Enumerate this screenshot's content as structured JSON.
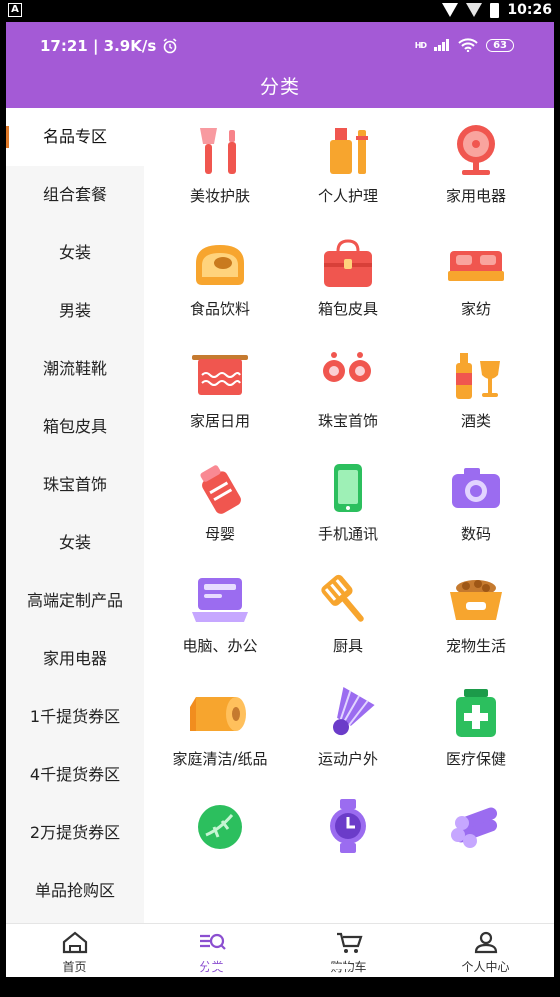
{
  "system_bar": {
    "app_icon": "A",
    "time": "10:26"
  },
  "header": {
    "status_time_speed": "17:21 | 3.9K/s",
    "network": "HD",
    "battery": "63",
    "title": "分类"
  },
  "sidebar": {
    "items": [
      {
        "label": "名品专区",
        "active": true
      },
      {
        "label": "组合套餐"
      },
      {
        "label": "女装"
      },
      {
        "label": "男装"
      },
      {
        "label": "潮流鞋靴"
      },
      {
        "label": "箱包皮具"
      },
      {
        "label": "珠宝首饰"
      },
      {
        "label": "女装"
      },
      {
        "label": "高端定制产品"
      },
      {
        "label": "家用电器"
      },
      {
        "label": "1千提货券区"
      },
      {
        "label": "4千提货券区"
      },
      {
        "label": "2万提货券区"
      },
      {
        "label": "单品抢购区"
      }
    ]
  },
  "categories": [
    {
      "label": "美妆护肤",
      "icon": "makeup-brush-icon"
    },
    {
      "label": "个人护理",
      "icon": "toiletries-icon"
    },
    {
      "label": "家用电器",
      "icon": "electric-fan-icon"
    },
    {
      "label": "食品饮料",
      "icon": "bread-icon"
    },
    {
      "label": "箱包皮具",
      "icon": "handbag-icon"
    },
    {
      "label": "家纺",
      "icon": "bed-icon"
    },
    {
      "label": "家居日用",
      "icon": "towel-icon"
    },
    {
      "label": "珠宝首饰",
      "icon": "earrings-icon"
    },
    {
      "label": "酒类",
      "icon": "wine-icon"
    },
    {
      "label": "母婴",
      "icon": "baby-bottle-icon"
    },
    {
      "label": "手机通讯",
      "icon": "mobile-phone-icon"
    },
    {
      "label": "数码",
      "icon": "camera-icon"
    },
    {
      "label": "电脑、办公",
      "icon": "laptop-icon"
    },
    {
      "label": "厨具",
      "icon": "spatula-icon"
    },
    {
      "label": "宠物生活",
      "icon": "pet-bowl-icon"
    },
    {
      "label": "家庭清洁/纸品",
      "icon": "paper-roll-icon"
    },
    {
      "label": "运动户外",
      "icon": "shuttlecock-icon"
    },
    {
      "label": "医疗保健",
      "icon": "medicine-box-icon"
    },
    {
      "label": "",
      "icon": "cabbage-icon"
    },
    {
      "label": "",
      "icon": "watch-icon"
    },
    {
      "label": "",
      "icon": "wood-logs-icon"
    }
  ],
  "bottom_nav": [
    {
      "label": "首页",
      "icon": "home-icon"
    },
    {
      "label": "分类",
      "icon": "category-icon",
      "active": true
    },
    {
      "label": "购物车",
      "icon": "cart-icon"
    },
    {
      "label": "个人中心",
      "icon": "user-icon"
    }
  ],
  "colors": {
    "header": "#a45ad6",
    "accent": "#8b4fd0",
    "icon_primary": "#f0564f",
    "icon_secondary": "#f7a52e"
  }
}
